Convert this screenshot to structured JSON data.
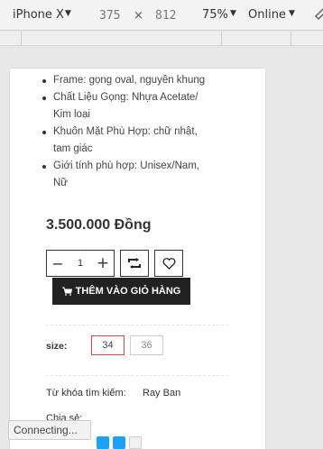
{
  "devtools": {
    "device": "iPhone X",
    "width": "375",
    "times": "×",
    "height": "812",
    "zoom": "75%",
    "network": "Online"
  },
  "product": {
    "specs": [
      "Frame: gọng oval, nguyên khung",
      "Chất Liệu Gọng: Nhựa Acetate/",
      "Kim loại",
      "Khuôn Mặt Phù Hợp: chữ nhật,",
      "tam giác",
      "Giới tính phù hợp: Unisex/Nam,",
      "Nữ"
    ],
    "price": "3.500.000 Đồng",
    "quantity": {
      "minus": "−",
      "value": "1",
      "plus": "+"
    },
    "add_to_cart": "THÊM VÀO GIỎ HÀNG",
    "size_label": "size:",
    "sizes": [
      "34",
      "36"
    ],
    "selected_size": "34",
    "keyword_label": "Từ khóa tìm kiếm:",
    "keyword_value": "Ray Ban",
    "share_label": "Chia sẻ:"
  },
  "status": {
    "toast": "Connecting..."
  },
  "colors": {
    "accent_border": "#e04343",
    "button_bg": "#222222"
  }
}
